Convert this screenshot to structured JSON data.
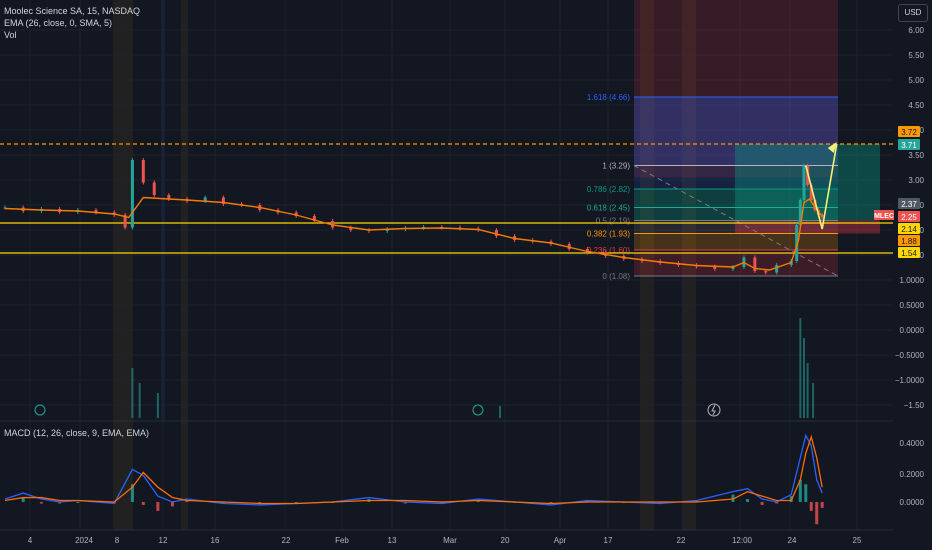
{
  "header": {
    "title": "Moolec Science SA, 15, NASDAQ",
    "ema_label": "EMA (26, close, 0, SMA, 5)",
    "vol_label": "Vol",
    "macd_label": "MACD (12, 26, close, 9, EMA, EMA)",
    "currency": "USD"
  },
  "colors": {
    "background": "#131722",
    "grid": "#1e222d",
    "candle_up": "#26a69a",
    "candle_down": "#ef5350",
    "ema": "#f57c00",
    "macd_line": "#2962ff",
    "signal_line": "#ff6d00",
    "hline": "#ffd600",
    "resistance": "#ff9800",
    "projection": "#f5f07a"
  },
  "chart_data": {
    "type": "candlestick",
    "price_axis": {
      "ticks": [
        "6.00",
        "5.50",
        "5.00",
        "4.50",
        "4.00",
        "3.50",
        "3.00",
        "2.50",
        "2.00",
        "1.50",
        "1.0000",
        "0.5000",
        "0.0000",
        "−0.5000",
        "−1.0000",
        "−1.50"
      ],
      "tags": [
        {
          "text": "3.72",
          "color": "#ff9800",
          "text_color": "#131722"
        },
        {
          "text": "3.71",
          "color": "#26a69a",
          "text_color": "#ffffff"
        },
        {
          "text": "2.37",
          "color": "#4f5966",
          "text_color": "#ffffff"
        },
        {
          "text": "MLEC",
          "color": "#ef5350",
          "text_color": "#ffffff"
        },
        {
          "text": "2.25",
          "color": "#ef5350",
          "text_color": "#ffffff"
        },
        {
          "text": "2.14",
          "color": "#ffd600",
          "text_color": "#131722"
        },
        {
          "text": "1.88",
          "color": "#ff9800",
          "text_color": "#131722"
        },
        {
          "text": "1.54",
          "color": "#ffd600",
          "text_color": "#131722"
        }
      ]
    },
    "macd_axis": {
      "ticks": [
        "0.4000",
        "0.2000",
        "0.0000"
      ]
    },
    "time_axis": {
      "labels": [
        "4",
        "2024",
        "8",
        "12",
        "16",
        "22",
        "Feb",
        "13",
        "Mar",
        "20",
        "Apr",
        "17",
        "22",
        "12:00",
        "24",
        "25"
      ]
    },
    "fib_levels": [
      {
        "ratio": "1.618",
        "price": 4.66,
        "label": "1.618 (4.66)",
        "color": "#2962ff"
      },
      {
        "ratio": "1",
        "price": 3.29,
        "label": "1 (3.29)",
        "color": "#b2b5be"
      },
      {
        "ratio": "0.786",
        "price": 2.82,
        "label": "0.786 (2.82)",
        "color": "#089981"
      },
      {
        "ratio": "0.618",
        "price": 2.45,
        "label": "0.618 (2.45)",
        "color": "#22ab94"
      },
      {
        "ratio": "0.5",
        "price": 2.19,
        "label": "0.5 (2.19)",
        "color": "#787b86"
      },
      {
        "ratio": "0.382",
        "price": 1.93,
        "label": "0.382 (1.93)",
        "color": "#ff9800"
      },
      {
        "ratio": "0.236",
        "price": 1.6,
        "label": "0.236 (1.60)",
        "color": "#f23645"
      },
      {
        "ratio": "0",
        "price": 1.08,
        "label": "0 (1.08)",
        "color": "#787b86"
      }
    ],
    "horizontal_lines": [
      {
        "price": 2.14,
        "color": "#ffd600",
        "style": "solid"
      },
      {
        "price": 1.54,
        "color": "#ffd600",
        "style": "solid"
      },
      {
        "price": 3.72,
        "color": "#ff9800",
        "style": "dashed"
      }
    ],
    "projection_path": [
      {
        "x": 22.0,
        "price": 3.29
      },
      {
        "x": 22.45,
        "price": 2.02
      },
      {
        "x": 22.85,
        "price": 3.72
      }
    ],
    "price_series": [
      {
        "x": 0,
        "close": 2.45
      },
      {
        "x": 0.5,
        "close": 2.38
      },
      {
        "x": 1,
        "close": 2.42
      },
      {
        "x": 1.5,
        "close": 2.36
      },
      {
        "x": 2,
        "close": 2.4
      },
      {
        "x": 2.5,
        "close": 2.35
      },
      {
        "x": 3,
        "close": 2.3
      },
      {
        "x": 3.3,
        "close": 2.05
      },
      {
        "x": 3.5,
        "close": 3.4
      },
      {
        "x": 3.8,
        "close": 2.95
      },
      {
        "x": 4.1,
        "close": 2.7
      },
      {
        "x": 4.5,
        "close": 2.62
      },
      {
        "x": 5,
        "close": 2.58
      },
      {
        "x": 5.5,
        "close": 2.65
      },
      {
        "x": 6,
        "close": 2.52
      },
      {
        "x": 6.5,
        "close": 2.5
      },
      {
        "x": 7,
        "close": 2.4
      },
      {
        "x": 7.5,
        "close": 2.35
      },
      {
        "x": 8,
        "close": 2.28
      },
      {
        "x": 8.5,
        "close": 2.18
      },
      {
        "x": 9,
        "close": 2.05
      },
      {
        "x": 9.5,
        "close": 2.0
      },
      {
        "x": 10,
        "close": 1.98
      },
      {
        "x": 10.5,
        "close": 2.02
      },
      {
        "x": 11,
        "close": 2.04
      },
      {
        "x": 11.5,
        "close": 2.06
      },
      {
        "x": 12,
        "close": 2.05
      },
      {
        "x": 12.5,
        "close": 2.03
      },
      {
        "x": 13,
        "close": 2.0
      },
      {
        "x": 13.5,
        "close": 1.88
      },
      {
        "x": 14,
        "close": 1.8
      },
      {
        "x": 14.5,
        "close": 1.77
      },
      {
        "x": 15,
        "close": 1.72
      },
      {
        "x": 15.5,
        "close": 1.62
      },
      {
        "x": 16,
        "close": 1.55
      },
      {
        "x": 16.5,
        "close": 1.48
      },
      {
        "x": 17,
        "close": 1.42
      },
      {
        "x": 17.5,
        "close": 1.38
      },
      {
        "x": 18,
        "close": 1.34
      },
      {
        "x": 18.5,
        "close": 1.3
      },
      {
        "x": 19,
        "close": 1.27
      },
      {
        "x": 19.5,
        "close": 1.22
      },
      {
        "x": 20,
        "close": 1.26
      },
      {
        "x": 20.3,
        "close": 1.45
      },
      {
        "x": 20.6,
        "close": 1.18
      },
      {
        "x": 20.9,
        "close": 1.15
      },
      {
        "x": 21.2,
        "close": 1.3
      },
      {
        "x": 21.6,
        "close": 1.38
      },
      {
        "x": 21.75,
        "close": 2.1
      },
      {
        "x": 21.85,
        "close": 2.6
      },
      {
        "x": 21.95,
        "close": 3.29
      },
      {
        "x": 22.05,
        "close": 2.9
      },
      {
        "x": 22.15,
        "close": 2.6
      },
      {
        "x": 22.25,
        "close": 2.4
      },
      {
        "x": 22.35,
        "close": 2.3
      },
      {
        "x": 22.45,
        "close": 2.25
      }
    ],
    "ema_series": [
      {
        "x": 0,
        "v": 2.43
      },
      {
        "x": 1,
        "v": 2.4
      },
      {
        "x": 2,
        "v": 2.38
      },
      {
        "x": 3,
        "v": 2.32
      },
      {
        "x": 3.4,
        "v": 2.25
      },
      {
        "x": 3.8,
        "v": 2.65
      },
      {
        "x": 4.5,
        "v": 2.62
      },
      {
        "x": 5,
        "v": 2.6
      },
      {
        "x": 6,
        "v": 2.55
      },
      {
        "x": 7,
        "v": 2.45
      },
      {
        "x": 8,
        "v": 2.3
      },
      {
        "x": 9,
        "v": 2.1
      },
      {
        "x": 10,
        "v": 2.0
      },
      {
        "x": 11,
        "v": 2.03
      },
      {
        "x": 12,
        "v": 2.04
      },
      {
        "x": 13,
        "v": 2.01
      },
      {
        "x": 14,
        "v": 1.83
      },
      {
        "x": 15,
        "v": 1.74
      },
      {
        "x": 16,
        "v": 1.57
      },
      {
        "x": 17,
        "v": 1.45
      },
      {
        "x": 18,
        "v": 1.36
      },
      {
        "x": 19,
        "v": 1.29
      },
      {
        "x": 20,
        "v": 1.26
      },
      {
        "x": 20.3,
        "v": 1.35
      },
      {
        "x": 20.6,
        "v": 1.23
      },
      {
        "x": 21,
        "v": 1.2
      },
      {
        "x": 21.6,
        "v": 1.35
      },
      {
        "x": 21.8,
        "v": 1.8
      },
      {
        "x": 21.95,
        "v": 2.55
      },
      {
        "x": 22.1,
        "v": 2.62
      },
      {
        "x": 22.3,
        "v": 2.4
      },
      {
        "x": 22.45,
        "v": 2.28
      }
    ],
    "volume_spikes": [
      {
        "x": 3.5,
        "v": 0.5
      },
      {
        "x": 3.7,
        "v": 0.35
      },
      {
        "x": 4.2,
        "v": 0.25
      },
      {
        "x": 13.6,
        "v": 0.12
      },
      {
        "x": 21.85,
        "v": 1.0
      },
      {
        "x": 21.95,
        "v": 0.8
      },
      {
        "x": 22.05,
        "v": 0.55
      },
      {
        "x": 22.2,
        "v": 0.35
      }
    ],
    "macd_series": [
      {
        "x": 0,
        "macd": 0.02,
        "signal": 0.01
      },
      {
        "x": 0.5,
        "macd": 0.06,
        "signal": 0.03
      },
      {
        "x": 1,
        "macd": 0.02,
        "signal": 0.03
      },
      {
        "x": 1.5,
        "macd": 0.0,
        "signal": 0.01
      },
      {
        "x": 2,
        "macd": 0.01,
        "signal": 0.01
      },
      {
        "x": 3,
        "macd": -0.01,
        "signal": 0.0
      },
      {
        "x": 3.5,
        "macd": 0.22,
        "signal": 0.1
      },
      {
        "x": 3.8,
        "macd": 0.18,
        "signal": 0.2
      },
      {
        "x": 4.2,
        "macd": 0.04,
        "signal": 0.1
      },
      {
        "x": 4.6,
        "macd": 0.0,
        "signal": 0.03
      },
      {
        "x": 5,
        "macd": 0.02,
        "signal": 0.01
      },
      {
        "x": 6,
        "macd": -0.01,
        "signal": 0.0
      },
      {
        "x": 7,
        "macd": -0.02,
        "signal": -0.01
      },
      {
        "x": 8,
        "macd": -0.01,
        "signal": -0.01
      },
      {
        "x": 9,
        "macd": 0.0,
        "signal": 0.0
      },
      {
        "x": 10,
        "macd": 0.03,
        "signal": 0.01
      },
      {
        "x": 11,
        "macd": 0.0,
        "signal": 0.01
      },
      {
        "x": 12,
        "macd": -0.01,
        "signal": 0.0
      },
      {
        "x": 13,
        "macd": 0.02,
        "signal": 0.01
      },
      {
        "x": 14,
        "macd": 0.0,
        "signal": 0.0
      },
      {
        "x": 15,
        "macd": -0.02,
        "signal": -0.01
      },
      {
        "x": 16,
        "macd": 0.01,
        "signal": 0.0
      },
      {
        "x": 17,
        "macd": 0.0,
        "signal": 0.0
      },
      {
        "x": 18,
        "macd": -0.01,
        "signal": 0.0
      },
      {
        "x": 19,
        "macd": 0.01,
        "signal": 0.0
      },
      {
        "x": 20,
        "macd": 0.07,
        "signal": 0.02
      },
      {
        "x": 20.4,
        "macd": 0.09,
        "signal": 0.07
      },
      {
        "x": 20.8,
        "macd": 0.02,
        "signal": 0.04
      },
      {
        "x": 21.2,
        "macd": 0.0,
        "signal": 0.01
      },
      {
        "x": 21.6,
        "macd": 0.05,
        "signal": 0.01
      },
      {
        "x": 21.85,
        "macd": 0.3,
        "signal": 0.15
      },
      {
        "x": 22.0,
        "macd": 0.45,
        "signal": 0.33
      },
      {
        "x": 22.15,
        "macd": 0.38,
        "signal": 0.44
      },
      {
        "x": 22.3,
        "macd": 0.15,
        "signal": 0.3
      },
      {
        "x": 22.45,
        "macd": 0.06,
        "signal": 0.1
      }
    ]
  }
}
